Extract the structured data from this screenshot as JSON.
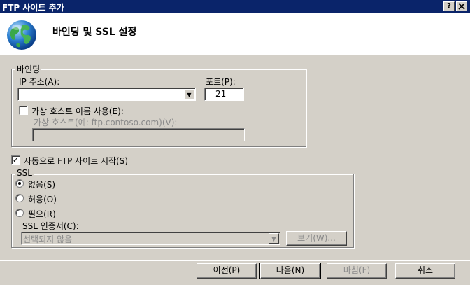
{
  "window": {
    "title": "FTP 사이트 추가",
    "help_label": "?",
    "close_label": "X"
  },
  "header": {
    "title": "바인딩 및 SSL 설정"
  },
  "binding": {
    "group_label": "바인딩",
    "ip_label": "IP 주소(A):",
    "ip_value": "",
    "port_label": "포트(P):",
    "port_value": "21",
    "virtual_host_checkbox_label": "가상 호스트 이름 사용(E):",
    "virtual_host_checked": false,
    "virtual_host_label": "가상 호스트(예: ftp.contoso.com)(V):",
    "virtual_host_value": ""
  },
  "auto_start": {
    "label": "자동으로 FTP 사이트 시작(S)",
    "checked": true
  },
  "ssl": {
    "group_label": "SSL",
    "options": [
      {
        "label": "없음(S)",
        "selected": true
      },
      {
        "label": "허용(O)",
        "selected": false
      },
      {
        "label": "필요(R)",
        "selected": false
      }
    ],
    "cert_label": "SSL 인증서(C):",
    "cert_value": "선택되지 않음",
    "view_button": "보기(W)..."
  },
  "footer": {
    "prev_button": "이전(P)",
    "next_button": "다음(N)",
    "finish_button": "마침(F)",
    "cancel_button": "취소"
  },
  "icons": {
    "globe": "globe-icon",
    "dropdown": "chevron-down-icon"
  },
  "colors": {
    "titlebar": "#0a246a",
    "dialog_bg": "#d4d0c8",
    "disabled_text": "#8a8a8a"
  }
}
